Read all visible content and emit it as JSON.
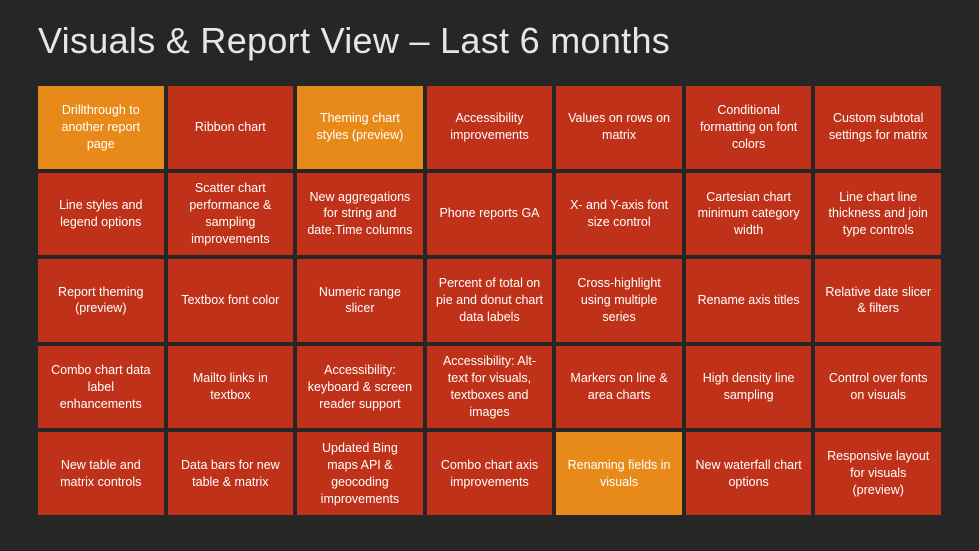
{
  "title": "Visuals & Report View – Last 6 months",
  "tiles": [
    {
      "label": "Drillthrough to another report page",
      "color": "c-orange"
    },
    {
      "label": "Ribbon chart",
      "color": "c-red"
    },
    {
      "label": "Theming chart styles (preview)",
      "color": "c-orange"
    },
    {
      "label": "Accessibility improvements",
      "color": "c-red"
    },
    {
      "label": "Values on rows on matrix",
      "color": "c-red"
    },
    {
      "label": "Conditional formatting on font colors",
      "color": "c-red"
    },
    {
      "label": "Custom subtotal settings for matrix",
      "color": "c-red"
    },
    {
      "label": "Line styles and legend options",
      "color": "c-red"
    },
    {
      "label": "Scatter chart performance & sampling improvements",
      "color": "c-red"
    },
    {
      "label": "New aggregations for string and date.Time columns",
      "color": "c-red"
    },
    {
      "label": "Phone reports GA",
      "color": "c-red"
    },
    {
      "label": "X- and Y-axis font size control",
      "color": "c-red"
    },
    {
      "label": "Cartesian chart minimum category width",
      "color": "c-red"
    },
    {
      "label": "Line chart line thickness and join type controls",
      "color": "c-red"
    },
    {
      "label": "Report theming (preview)",
      "color": "c-red"
    },
    {
      "label": "Textbox font color",
      "color": "c-red"
    },
    {
      "label": "Numeric range slicer",
      "color": "c-red"
    },
    {
      "label": "Percent of total on pie and donut chart data labels",
      "color": "c-red"
    },
    {
      "label": "Cross-highlight using multiple series",
      "color": "c-red"
    },
    {
      "label": "Rename axis titles",
      "color": "c-red"
    },
    {
      "label": "Relative date slicer & filters",
      "color": "c-red"
    },
    {
      "label": "Combo chart data label enhancements",
      "color": "c-red"
    },
    {
      "label": "Mailto links in textbox",
      "color": "c-red"
    },
    {
      "label": "Accessibility: keyboard & screen reader support",
      "color": "c-red"
    },
    {
      "label": "Accessibility: Alt-text for visuals, textboxes and images",
      "color": "c-red"
    },
    {
      "label": "Markers on line & area charts",
      "color": "c-red"
    },
    {
      "label": "High density line sampling",
      "color": "c-red"
    },
    {
      "label": "Control over fonts on visuals",
      "color": "c-red"
    },
    {
      "label": "New table and matrix controls",
      "color": "c-red"
    },
    {
      "label": "Data bars for new table & matrix",
      "color": "c-red"
    },
    {
      "label": "Updated Bing maps API & geocoding improvements",
      "color": "c-red"
    },
    {
      "label": "Combo chart axis improvements",
      "color": "c-red"
    },
    {
      "label": "Renaming fields in visuals",
      "color": "c-orange"
    },
    {
      "label": "New waterfall chart options",
      "color": "c-red"
    },
    {
      "label": "Responsive layout for visuals (preview)",
      "color": "c-red"
    }
  ]
}
